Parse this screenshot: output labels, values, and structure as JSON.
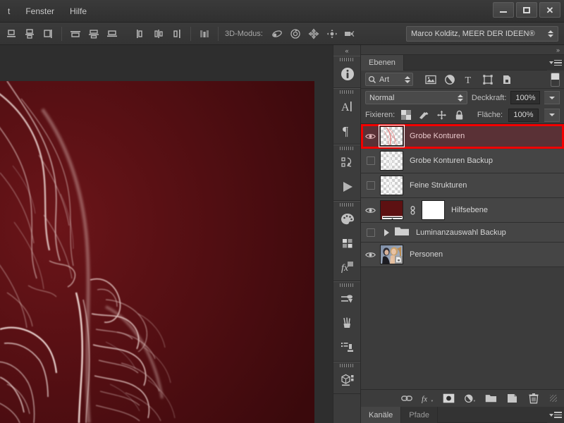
{
  "titlebar": {
    "menus": [
      "t",
      "Fenster",
      "Hilfe"
    ],
    "minimize_label": "Minimieren",
    "maximize_label": "Maximieren",
    "close_label": "Schließen"
  },
  "optionsbar": {
    "mode3d_label": "3D-Modus:",
    "align_icons": [
      "align-bottom-edges-icon",
      "align-vertical-centers-icon",
      "align-right-edges-icon",
      "distribute-top-edges-icon",
      "distribute-vertical-centers-icon",
      "distribute-bottom-edges-icon",
      "distribute-left-edges-icon",
      "distribute-horizontal-centers-icon",
      "distribute-right-edges-icon",
      "auto-align-layers-icon"
    ],
    "mode3d_icons": [
      "orbit-3d-icon",
      "roll-3d-icon",
      "pan-3d-icon",
      "slide-3d-icon",
      "camera-3d-icon"
    ],
    "workspace": "Marco Kolditz, MEER DER IDEEN®"
  },
  "rail": {
    "collapse_label": "«",
    "groups": [
      {
        "items": [
          {
            "icon": "info-icon",
            "label": "Info"
          }
        ]
      },
      {
        "items": [
          {
            "icon": "character-icon",
            "label": "Zeichen"
          },
          {
            "icon": "paragraph-icon",
            "label": "Absatz"
          }
        ]
      },
      {
        "items": [
          {
            "icon": "actions-icon",
            "label": "Aktionen"
          },
          {
            "icon": "timeline-play-icon",
            "label": "Zeitleiste"
          }
        ]
      },
      {
        "items": [
          {
            "icon": "color-palette-icon",
            "label": "Farbe"
          },
          {
            "icon": "swatches-icon",
            "label": "Farbfelder"
          },
          {
            "icon": "layer-styles-fx-icon",
            "label": "Formatvorlagen"
          }
        ]
      },
      {
        "items": [
          {
            "icon": "brush-adjust-icon",
            "label": "Korrekturen"
          },
          {
            "icon": "brushes-icon",
            "label": "Pinsel"
          },
          {
            "icon": "brush-presets-icon",
            "label": "Pinselvorgaben"
          }
        ]
      },
      {
        "items": [
          {
            "icon": "cube-3d-icon",
            "label": "3D"
          }
        ]
      }
    ]
  },
  "panel": {
    "collapse_label": "»",
    "tabs": [
      {
        "label": "Ebenen",
        "active": true
      }
    ],
    "menu_icon": "panel-menu-icon",
    "filter": {
      "search_icon": "search-icon",
      "kind_value": "Art",
      "type_icons": [
        "filter-pixel-icon",
        "filter-adjustment-icon",
        "filter-type-icon",
        "filter-shape-icon",
        "filter-smartobject-icon"
      ],
      "toggle_icon": "filter-enable-toggle"
    },
    "blend": {
      "mode": "Normal",
      "opacity_label": "Deckkraft:",
      "opacity_value": "100%"
    },
    "lock": {
      "label": "Fixieren:",
      "icons": [
        "lock-transparency-icon",
        "lock-image-pixels-icon",
        "lock-position-icon",
        "lock-all-icon"
      ],
      "fill_label": "Fläche:",
      "fill_value": "100%"
    },
    "layers": [
      {
        "name": "Grobe Konturen",
        "visible": true,
        "selected": true,
        "thumb": "contours-red",
        "kind": "pixel"
      },
      {
        "name": "Grobe Konturen Backup",
        "visible": false,
        "selected": false,
        "thumb": "contours-gray",
        "kind": "pixel"
      },
      {
        "name": "Feine Strukturen",
        "visible": false,
        "selected": false,
        "thumb": "structures-gray",
        "kind": "pixel"
      },
      {
        "name": "Hilfsebene",
        "visible": true,
        "selected": false,
        "thumb": "gradient-dark-red",
        "kind": "adjustment-with-mask",
        "has_link": true,
        "has_mask": true
      },
      {
        "name": "Luminanzauswahl Backup",
        "visible": false,
        "selected": false,
        "thumb": "folder",
        "kind": "group"
      },
      {
        "name": "Personen",
        "visible": true,
        "selected": false,
        "thumb": "couple-photo",
        "kind": "smart-object"
      }
    ],
    "bottom_icons": [
      {
        "icon": "link-layers-icon",
        "label": "Ebenen verknüpfen"
      },
      {
        "icon": "layer-style-fx-icon",
        "label": "Ebenenstil hinzufügen"
      },
      {
        "icon": "add-layer-mask-icon",
        "label": "Ebenenmaske hinzufügen"
      },
      {
        "icon": "new-adjustment-layer-icon",
        "label": "Neue Einstellungsebene"
      },
      {
        "icon": "new-group-icon",
        "label": "Neue Gruppe"
      },
      {
        "icon": "new-layer-icon",
        "label": "Neue Ebene"
      },
      {
        "icon": "delete-layer-icon",
        "label": "Ebene löschen"
      }
    ]
  },
  "bottom_panel": {
    "tabs": [
      {
        "label": "Kanäle",
        "active": true
      },
      {
        "label": "Pfade",
        "active": false
      }
    ],
    "menu_icon": "panel-menu-icon"
  },
  "canvas": {
    "document_label": "Bilddokument",
    "background_color": "#4a0f11",
    "line_color": "#f0d8d4"
  }
}
